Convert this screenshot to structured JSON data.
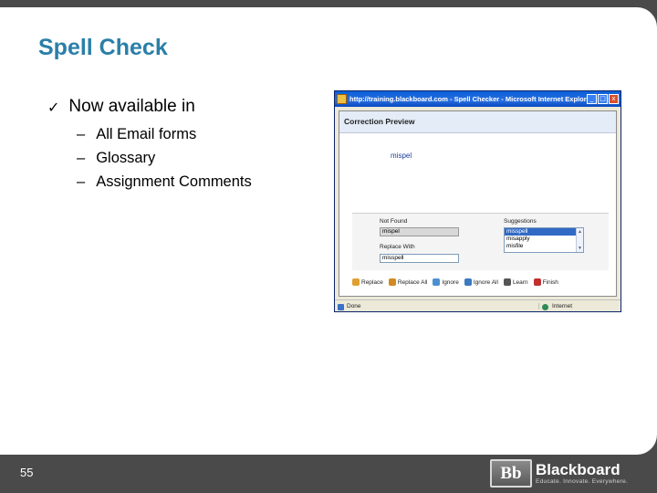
{
  "slide": {
    "title": "Spell Check",
    "bullet": "Now available in",
    "check_glyph": "✓",
    "dash_glyph": "–",
    "subitems": [
      "All Email forms",
      "Glossary",
      "Assignment Comments"
    ],
    "page_number": "55"
  },
  "window": {
    "title": "http://training.blackboard.com - Spell Checker - Microsoft Internet Explorer",
    "btn_minimize": "_",
    "btn_maximize": "□",
    "btn_close": "x",
    "header": "Correction Preview",
    "preview_word": "mispel",
    "not_found_label": "Not Found",
    "not_found_value": "mispel",
    "replace_with_label": "Replace With",
    "replace_with_value": "misspell",
    "suggestions_label": "Suggestions",
    "suggestions": [
      "misspell",
      "misapply",
      "misfile"
    ],
    "scroll_up": "▲",
    "scroll_down": "▼",
    "buttons": {
      "replace": "Replace",
      "replace_all": "Replace All",
      "ignore": "Ignore",
      "ignore_all": "Ignore All",
      "learn": "Learn",
      "finish": "Finish"
    },
    "status_text": "Done",
    "status_zone": "Internet"
  },
  "logo": {
    "mark": "Bb",
    "name": "Blackboard",
    "tagline": "Educate. Innovate. Everywhere."
  },
  "colors": {
    "title": "#2a7fa8",
    "background": "#4a4a4a",
    "selection": "#316ac5"
  }
}
